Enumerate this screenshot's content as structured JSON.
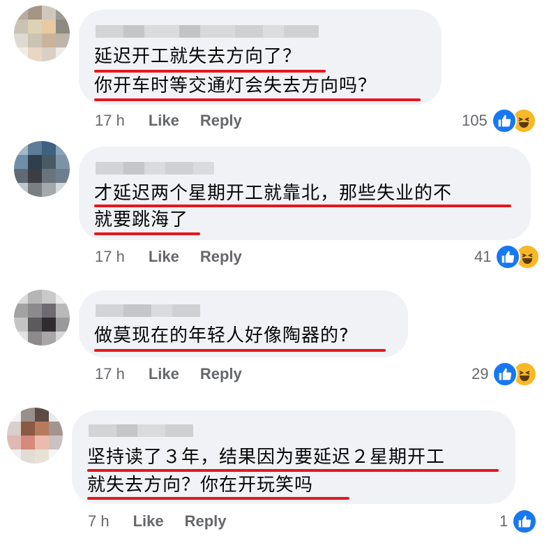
{
  "comments": [
    {
      "lines": [
        "延迟开工就失去方向了？",
        "你开车时等交通灯会失去方向吗？"
      ],
      "time": "17 h",
      "like_label": "Like",
      "reply_label": "Reply",
      "reaction_count": "105",
      "reactions": [
        "like-icon",
        "haha-icon"
      ]
    },
    {
      "lines": [
        "才延迟两个星期开工就靠北，那些失业的不",
        "就要跳海了"
      ],
      "time": "17 h",
      "like_label": "Like",
      "reply_label": "Reply",
      "reaction_count": "41",
      "reactions": [
        "like-icon",
        "haha-icon"
      ]
    },
    {
      "lines": [
        "做莫现在的年轻人好像陶器的?"
      ],
      "time": "17 h",
      "like_label": "Like",
      "reply_label": "Reply",
      "reaction_count": "29",
      "reactions": [
        "like-icon",
        "haha-icon"
      ]
    },
    {
      "lines": [
        "坚持读了３年，结果因为要延迟２星期开工",
        "就失去方向？你在开玩笑吗"
      ],
      "time": "7 h",
      "like_label": "Like",
      "reply_label": "Reply",
      "reaction_count": "1",
      "reactions": [
        "like-icon"
      ]
    }
  ],
  "colors": {
    "underline": "#e3181e",
    "bubble": "#f0f2f5",
    "like": "#1877f2",
    "haha": "#f7b928",
    "meta_text": "#65676b"
  }
}
